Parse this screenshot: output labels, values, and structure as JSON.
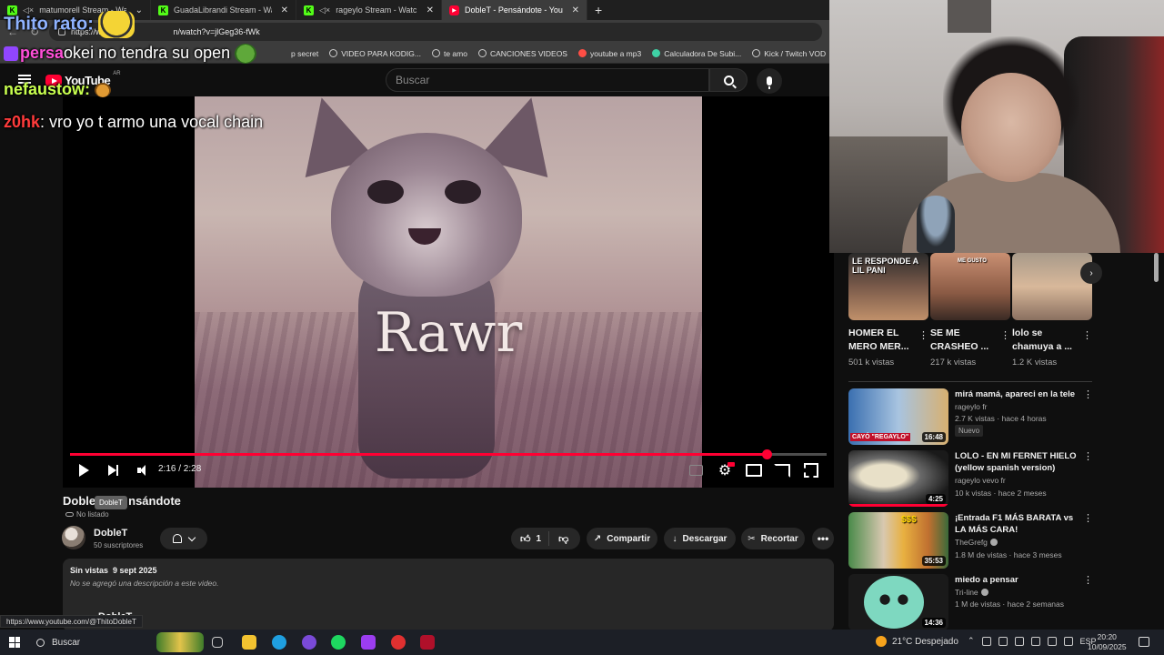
{
  "tabs": [
    {
      "title": "matumorell Stream - Watch",
      "icon": "kick-icon",
      "muted": true
    },
    {
      "title": "GuadaLibrandi Stream - Watch Li",
      "icon": "kick-icon",
      "muted": false
    },
    {
      "title": "rageylo Stream - Watch Live",
      "icon": "kick-icon",
      "muted": true
    },
    {
      "title": "DobleT - Pensándote - YouTube",
      "icon": "youtube-icon",
      "active": true
    }
  ],
  "address": {
    "url": "https://www.youtube.com/watch?v=jlGeg36-fWk",
    "url_visible_start": "https://www",
    "url_visible_end": "n/watch?v=jlGeg36-fWk"
  },
  "bookmarks": [
    "p secret",
    "VIDEO PARA KODIG...",
    "te amo",
    "CANCIONES VIDEOS",
    "youtube a mp3",
    "Calculadora De Subi...",
    "Kick / Twitch VOD"
  ],
  "masthead": {
    "logo": "YouTube",
    "country": "AR",
    "search_placeholder": "Buscar"
  },
  "chat_overlay": [
    {
      "user": "Thito rato:",
      "message": "",
      "color": "#8fb3ff"
    },
    {
      "user": "persa",
      "message": "okei no tendra su open",
      "color": "#ff4fd8"
    },
    {
      "user": "nefaustow:",
      "message": "",
      "color": "#c8ff4f"
    },
    {
      "user": "z0hk",
      "message": ": vro yo t armo una vocal chain",
      "color": "#ff3b3b"
    }
  ],
  "player": {
    "caption_text": "Rawr",
    "current_time": "2:16",
    "duration": "2:28",
    "time_display": "2:16 / 2:28",
    "progress_fraction": 0.921,
    "accent": "#ff0033"
  },
  "video": {
    "title_start": "Doble",
    "title_end": "nsándote",
    "tooltip": "DobleT",
    "visibility": "No listado",
    "channel": "DobleT",
    "subscribers": "50 suscriptores",
    "likes": "1",
    "share_label": "Compartir",
    "download_label": "Descargar",
    "clip_label": "Recortar",
    "views": "Sin vistas",
    "date": "9 sept 2025",
    "description": "No se agregó una descripción a este video.",
    "description_cut": "DobleT",
    "status_url": "https://www.youtube.com/@ThitoDobleT"
  },
  "shorts": [
    {
      "title": "HOMER EL MERO MER...",
      "views": "501 k vistas",
      "overlay": "LE RESPONDE A LIL PANI"
    },
    {
      "title": "SE ME CRASHEO ...",
      "views": "217 k vistas",
      "overlay": "ME GUSTO"
    },
    {
      "title": "lolo se chamuya a ...",
      "views": "1.2 K vistas",
      "overlay": ""
    }
  ],
  "recommendations": [
    {
      "title": "mirá mamá, apareci en la tele",
      "channel": "rageylo fr",
      "verified": false,
      "meta": "2.7 K vistas · hace 4 horas",
      "badge": "Nuevo",
      "duration": "16:48",
      "thumb_text": "CAYÓ \"REGAYLO\""
    },
    {
      "title": "LOLO - EN MI FERNET HIELO (yellow spanish version)",
      "channel": "rageylo vevo fr",
      "verified": false,
      "meta": "10 k vistas · hace 2 meses",
      "duration": "4:25"
    },
    {
      "title": "¡Entrada F1 MÁS BARATA vs LA MÁS CARA!",
      "channel": "TheGrefg",
      "verified": true,
      "meta": "1.8 M de vistas · hace 3 meses",
      "duration": "35:53",
      "thumb_text": "$$$"
    },
    {
      "title": "miedo a pensar",
      "channel": "Tri-line",
      "verified": true,
      "meta": "1 M de vistas · hace 2 semanas",
      "duration": "14:36"
    }
  ],
  "taskbar": {
    "search": "Buscar",
    "weather": "21°C  Despejado",
    "lang": "ESP",
    "time": "20:20",
    "date": "10/09/2025"
  }
}
